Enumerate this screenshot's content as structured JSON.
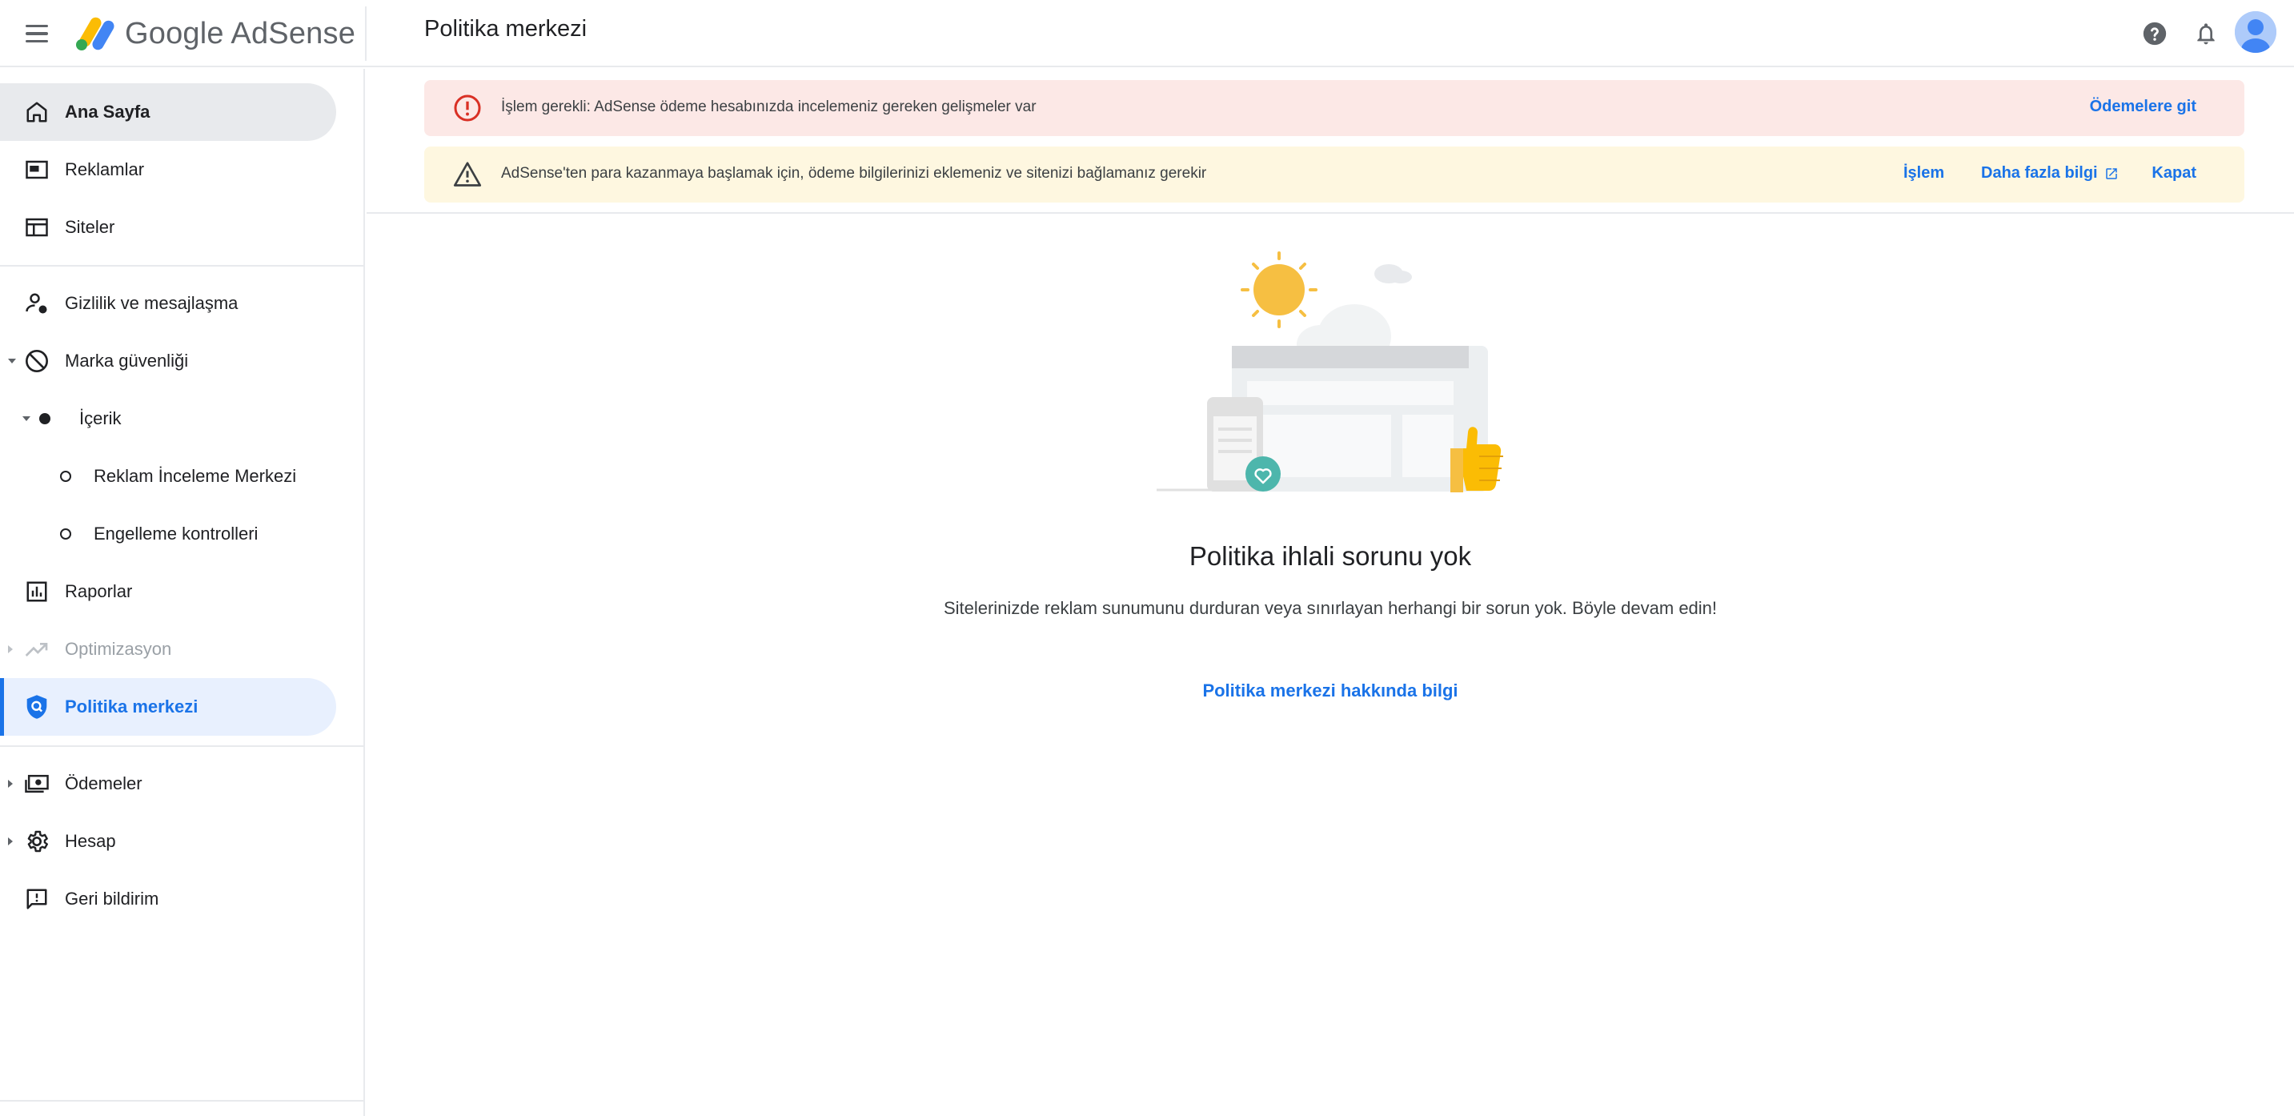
{
  "header": {
    "logo_text": "Google AdSense",
    "page_title": "Politika merkezi"
  },
  "sidebar": {
    "items": [
      {
        "label": "Ana Sayfa"
      },
      {
        "label": "Reklamlar"
      },
      {
        "label": "Siteler"
      },
      {
        "label": "Gizlilik ve mesajlaşma"
      },
      {
        "label": "Marka güvenliği"
      },
      {
        "label": "İçerik"
      },
      {
        "label": "Reklam İnceleme Merkezi"
      },
      {
        "label": "Engelleme kontrolleri"
      },
      {
        "label": "Raporlar"
      },
      {
        "label": "Optimizasyon"
      },
      {
        "label": "Politika merkezi"
      },
      {
        "label": "Ödemeler"
      },
      {
        "label": "Hesap"
      },
      {
        "label": "Geri bildirim"
      }
    ]
  },
  "banners": {
    "error": {
      "text": "İşlem gerekli: AdSense ödeme hesabınızda incelemeniz gereken gelişmeler var",
      "action": "Ödemelere git"
    },
    "warning": {
      "text": "AdSense'ten para kazanmaya başlamak için, ödeme bilgilerinizi eklemeniz ve sitenizi bağlamanız gerekir",
      "action": "İşlem",
      "learn_more": "Daha fazla bilgi",
      "close": "Kapat"
    }
  },
  "empty_state": {
    "title": "Politika ihlali sorunu yok",
    "description": "Sitelerinizde reklam sunumunu durduran veya sınırlayan herhangi bir sorun yok. Böyle devam edin!",
    "link": "Politika merkezi hakkında bilgi"
  },
  "colors": {
    "accent": "#1a73e8",
    "error_bg": "#fce8e6",
    "warning_bg": "#fef7e0"
  }
}
